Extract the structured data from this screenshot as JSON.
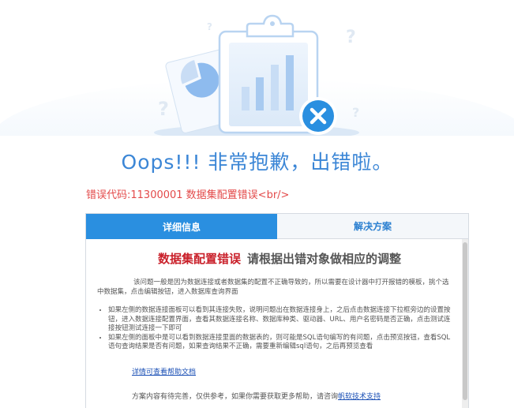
{
  "title": "Oops!!! 非常抱歉，出错啦。",
  "error_line": "错误代码:11300001 数据集配置错误<br/>",
  "tabs": [
    {
      "label": "详细信息"
    },
    {
      "label": "解决方案"
    }
  ],
  "content": {
    "heading_red": "数据集配置错误",
    "heading_gray": "请根据出错对象做相应的调整",
    "paragraph": "该问题一般是因为数据连接或者数据集的配置不正确导致的，所以需要在设计器中打开报错的模板，挑个选中数据集，点击编辑按钮，进入数据库查询界面",
    "bullets": [
      "如果左侧的数据连接面板可以看到其连接失败，说明问题出在数据连接身上，之后点击数据连接下拉框旁边的设置按钮，进入数据连接配置界面，查看其数据连接名称、数据库种类、驱动器、URL、用户名密码是否正确，点击测试连接按钮测试连接一下即可",
      "如果左侧的面板中是可以看到数据连接里面的数据表的，则可能是SQL语句编写的有问题，点击预览按钮，查看SQL语句查询结果是否有问题，如果查询结果不正确，需要重新编辑sql语句，之后再预览查看"
    ],
    "help_link": "详情可查看帮助文档",
    "footer_text": "方案内容有待完善，仅供参考，如果你需要获取更多帮助，请咨询",
    "footer_link": "帆软技术支持"
  },
  "colors": {
    "title_blue": "#3b86d6",
    "error_red": "#e34a4a",
    "tab_active": "#2a8fe0",
    "close_badge": "#2a8fe0"
  },
  "icons": [
    "document-chart-illustration",
    "pie-chart-card-icon",
    "close-icon",
    "question-mark-icon"
  ]
}
